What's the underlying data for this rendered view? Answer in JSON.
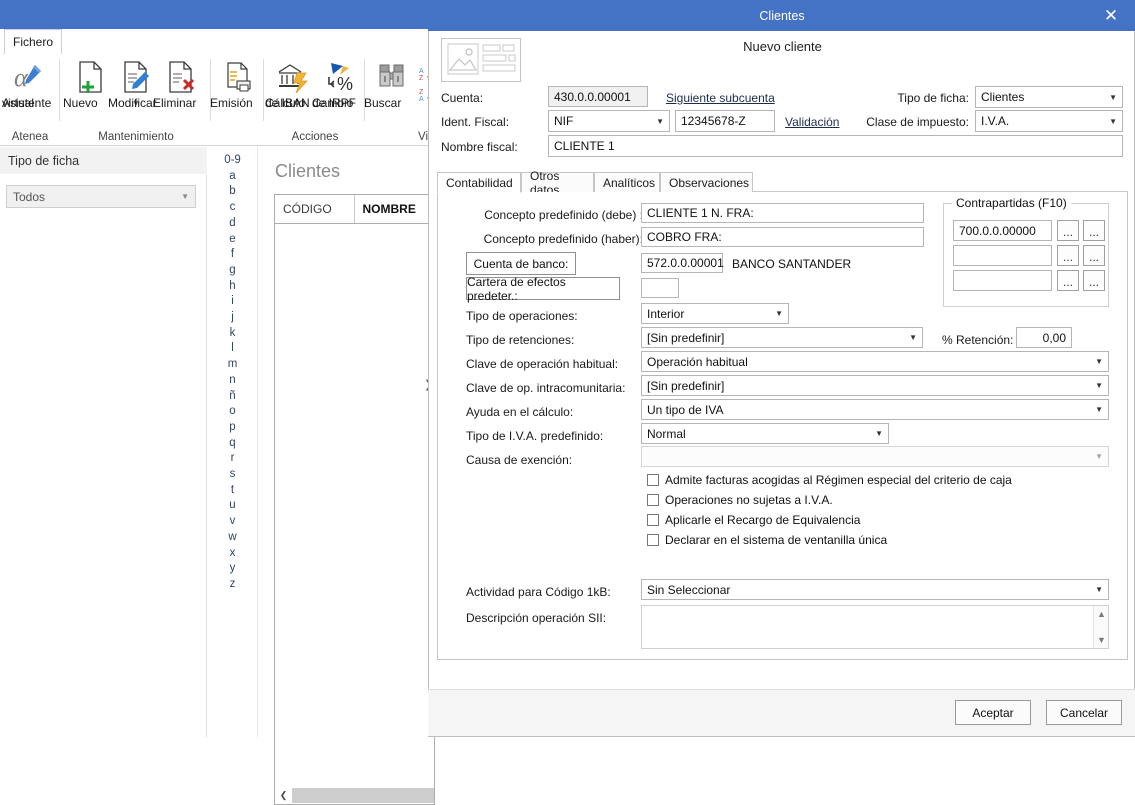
{
  "window": {
    "file_tab": "Fichero",
    "ribbon_groups": [
      {
        "title": "Atenea",
        "items": [
          {
            "label_line1": "Asistente",
            "label_line2": "virtual",
            "icon": "alpha-pen-icon"
          }
        ]
      },
      {
        "title": "Mantenimiento",
        "items": [
          {
            "label_line1": "Nuevo",
            "label_line2": "",
            "icon": "new-document-icon"
          },
          {
            "label_line1": "Modificar",
            "label_line2": "",
            "icon": "edit-document-icon",
            "has_caret": true
          },
          {
            "label_line1": "Eliminar",
            "label_line2": "",
            "icon": "delete-document-icon"
          }
        ]
      },
      {
        "title": "",
        "items": [
          {
            "label_line1": "Emisión",
            "label_line2": "",
            "icon": "print-document-icon"
          }
        ]
      },
      {
        "title": "Acciones",
        "items": [
          {
            "label_line1": "Cálculo",
            "label_line2": "de IBAN",
            "icon": "bank-bolt-icon"
          },
          {
            "label_line1": "Cambio",
            "label_line2": "de IRPF",
            "icon": "percent-agency-icon"
          }
        ]
      },
      {
        "title": "Vi",
        "items": [
          {
            "label_line1": "Buscar",
            "label_line2": "",
            "icon": "binoculars-icon"
          }
        ]
      }
    ],
    "sort_icons": [
      "sort-az-icon",
      "sort-za-icon"
    ]
  },
  "left_pane": {
    "header": "Tipo de ficha",
    "filter_value": "Todos"
  },
  "alphabet": [
    "0-9",
    "a",
    "b",
    "c",
    "d",
    "e",
    "f",
    "g",
    "h",
    "i",
    "j",
    "k",
    "l",
    "m",
    "n",
    "ñ",
    "o",
    "p",
    "q",
    "r",
    "s",
    "t",
    "u",
    "v",
    "w",
    "x",
    "y",
    "z"
  ],
  "list_pane": {
    "title": "Clientes",
    "columns": [
      "CÓDIGO",
      "NOMBRE"
    ],
    "rows": []
  },
  "dialog": {
    "title": "Clientes",
    "close_label": "✕",
    "heading": "Nuevo cliente",
    "header_fields": {
      "cuenta_label": "Cuenta:",
      "cuenta_value": "430.0.0.00001",
      "siguiente_subcuenta_link": "Siguiente subcuenta",
      "tipo_ficha_label": "Tipo de ficha:",
      "tipo_ficha_value": "Clientes",
      "ident_fiscal_label": "Ident. Fiscal:",
      "ident_fiscal_type": "NIF",
      "ident_fiscal_value": "12345678-Z",
      "validacion_link": "Validación",
      "clase_impuesto_label": "Clase de impuesto:",
      "clase_impuesto_value": "I.V.A.",
      "nombre_fiscal_label": "Nombre fiscal:",
      "nombre_fiscal_value": "CLIENTE 1"
    },
    "tabs": [
      {
        "label": "Contabilidad",
        "active": true
      },
      {
        "label": "Otros datos",
        "active": false
      },
      {
        "label": "Analíticos",
        "active": false
      },
      {
        "label": "Observaciones",
        "active": false
      }
    ],
    "contabilidad": {
      "concepto_debe_label": "Concepto predefinido (debe) :",
      "concepto_debe_value": "CLIENTE 1 N. FRA:",
      "concepto_haber_label": "Concepto predefinido (haber):",
      "concepto_haber_value": "COBRO FRA:",
      "cuenta_banco_button": "Cuenta de banco:",
      "cuenta_banco_value": "572.0.0.00001",
      "cuenta_banco_name": "BANCO SANTANDER",
      "cartera_button": "Cartera de efectos predeter.:",
      "cartera_value": "",
      "tipo_operaciones_label": "Tipo de operaciones:",
      "tipo_operaciones_value": "Interior",
      "tipo_retenciones_label": "Tipo de retenciones:",
      "tipo_retenciones_value": "[Sin predefinir]",
      "retencion_label": "% Retención:",
      "retencion_value": "0,00",
      "clave_operacion_label": "Clave de operación habitual:",
      "clave_operacion_value": "Operación habitual",
      "clave_intra_label": "Clave de op. intracomunitaria:",
      "clave_intra_value": "[Sin predefinir]",
      "ayuda_calculo_label": "Ayuda en el cálculo:",
      "ayuda_calculo_value": "Un tipo de IVA",
      "tipo_iva_label": "Tipo de I.V.A. predefinido:",
      "tipo_iva_value": "Normal",
      "causa_exencion_label": "Causa de exención:",
      "causa_exencion_value": "",
      "checkboxes": [
        {
          "label": "Admite facturas acogidas al Régimen especial del criterio de caja",
          "checked": false
        },
        {
          "label": "Operaciones no sujetas a I.V.A.",
          "checked": false
        },
        {
          "label": "Aplicarle el Recargo de Equivalencia",
          "checked": false
        },
        {
          "label": "Declarar en el sistema de ventanilla única",
          "checked": false
        }
      ],
      "actividad_label": "Actividad para Código 1kB:",
      "actividad_value": "Sin Seleccionar",
      "descripcion_sii_label": "Descripción operación SII:",
      "descripcion_sii_value": "",
      "contrapartidas": {
        "legend": "Contrapartidas (F10)",
        "rows": [
          {
            "value": "700.0.0.00000",
            "btn1": "...",
            "btn2": "..."
          },
          {
            "value": "",
            "btn1": "...",
            "btn2": "..."
          },
          {
            "value": "",
            "btn1": "...",
            "btn2": "..."
          }
        ]
      }
    },
    "footer": {
      "accept": "Aceptar",
      "cancel": "Cancelar"
    }
  },
  "colors": {
    "accent_blue": "#4472c4",
    "link": "#1c2b50",
    "alpha_text": "#31456b"
  }
}
